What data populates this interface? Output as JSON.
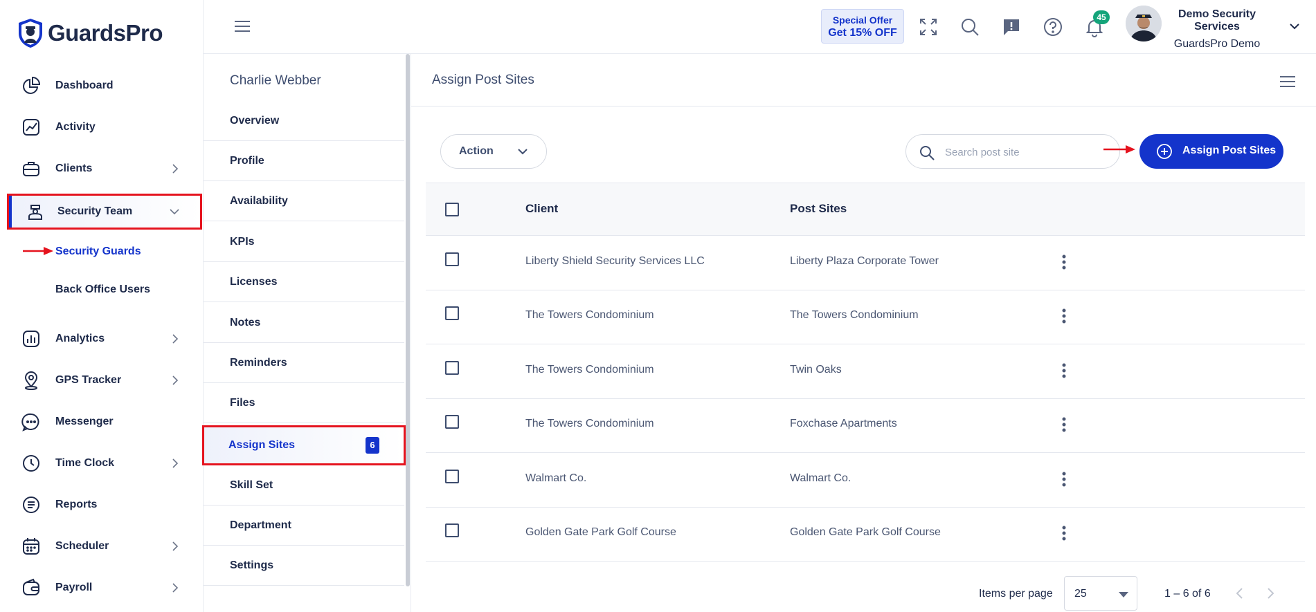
{
  "brand": {
    "name": "GuardsPro"
  },
  "sidebar": {
    "items": [
      {
        "label": "Dashboard"
      },
      {
        "label": "Activity"
      },
      {
        "label": "Clients"
      },
      {
        "label": "Security Team"
      },
      {
        "label": "Analytics"
      },
      {
        "label": "GPS Tracker"
      },
      {
        "label": "Messenger"
      },
      {
        "label": "Time Clock"
      },
      {
        "label": "Reports"
      },
      {
        "label": "Scheduler"
      },
      {
        "label": "Payroll"
      }
    ],
    "sub_items": [
      {
        "label": "Security Guards"
      },
      {
        "label": "Back Office Users"
      }
    ]
  },
  "header": {
    "offer_line1": "Special Offer",
    "offer_line2": "Get 15% OFF",
    "notification_count": "45",
    "company_name": "Demo Security Services",
    "account_name": "GuardsPro Demo"
  },
  "subnav": {
    "person_name": "Charlie Webber",
    "items": [
      {
        "label": "Overview"
      },
      {
        "label": "Profile"
      },
      {
        "label": "Availability"
      },
      {
        "label": "KPIs"
      },
      {
        "label": "Licenses"
      },
      {
        "label": "Notes"
      },
      {
        "label": "Reminders"
      },
      {
        "label": "Files"
      },
      {
        "label": "Assign Sites",
        "count": "6"
      },
      {
        "label": "Skill Set"
      },
      {
        "label": "Department"
      },
      {
        "label": "Settings"
      }
    ]
  },
  "main": {
    "title": "Assign Post Sites",
    "action_label": "Action",
    "search_placeholder": "Search post site",
    "assign_button_label": "Assign Post Sites",
    "columns": {
      "client": "Client",
      "post_sites": "Post Sites"
    },
    "rows": [
      {
        "client": "Liberty Shield Security Services LLC",
        "post_site": "Liberty Plaza Corporate Tower"
      },
      {
        "client": "The Towers Condominium",
        "post_site": "The Towers Condominium"
      },
      {
        "client": "The Towers Condominium",
        "post_site": "Twin Oaks"
      },
      {
        "client": "The Towers Condominium",
        "post_site": "Foxchase Apartments"
      },
      {
        "client": "Walmart Co.",
        "post_site": "Walmart Co."
      },
      {
        "client": "Golden Gate Park Golf Course",
        "post_site": "Golden Gate Park Golf Course"
      }
    ],
    "pagination": {
      "items_per_page_label": "Items per page",
      "items_per_page": "25",
      "range": "1 – 6 of 6"
    }
  },
  "colors": {
    "primary": "#1434cb",
    "highlight_border": "#e5131e",
    "badge_green": "#14a47a",
    "text_dark": "#1e2a4a"
  }
}
